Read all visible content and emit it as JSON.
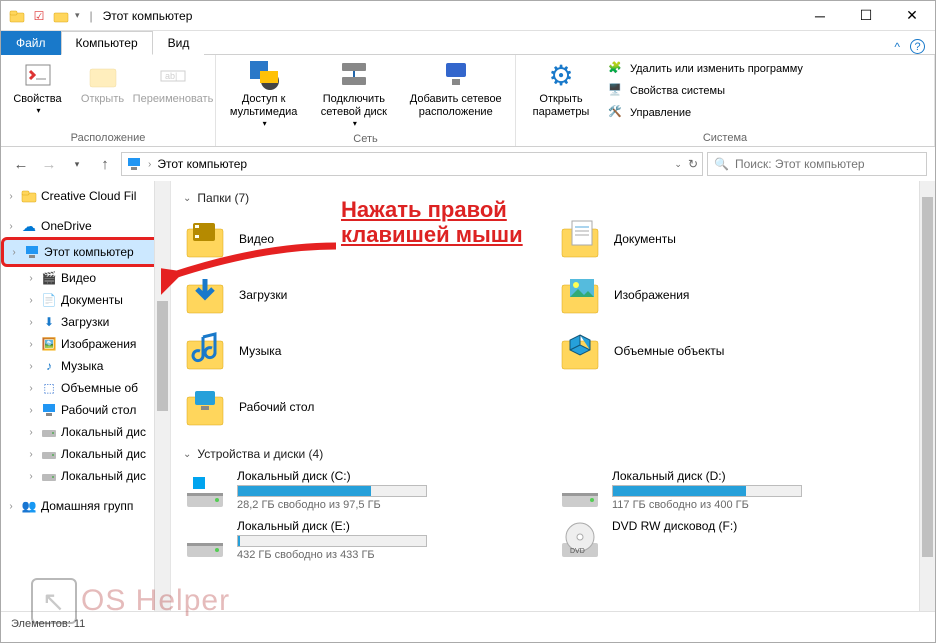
{
  "title": "Этот компьютер",
  "tabs": {
    "file": "Файл",
    "computer": "Компьютер",
    "view": "Вид"
  },
  "ribbon": {
    "group_location": {
      "label": "Расположение",
      "properties": "Свойства",
      "open": "Открыть",
      "rename": "Переименовать"
    },
    "group_network": {
      "label": "Сеть",
      "media": "Доступ к\nмультимедиа",
      "map": "Подключить\nсетевой диск",
      "addloc": "Добавить сетевое\nрасположение"
    },
    "group_system": {
      "label": "Система",
      "settings": "Открыть\nпараметры",
      "uninstall": "Удалить или изменить программу",
      "sysprops": "Свойства системы",
      "manage": "Управление"
    }
  },
  "address": {
    "text": "Этот компьютер",
    "search_placeholder": "Поиск: Этот компьютер"
  },
  "sidebar": {
    "items": [
      {
        "label": "Creative Cloud Fil",
        "icon": "folder"
      },
      {
        "label": "OneDrive",
        "icon": "onedrive"
      },
      {
        "label": "Этот компьютер",
        "icon": "pc",
        "highlighted": true
      },
      {
        "label": "Видео",
        "icon": "video",
        "indent": true
      },
      {
        "label": "Документы",
        "icon": "docs",
        "indent": true
      },
      {
        "label": "Загрузки",
        "icon": "downloads",
        "indent": true
      },
      {
        "label": "Изображения",
        "icon": "images",
        "indent": true
      },
      {
        "label": "Музыка",
        "icon": "music",
        "indent": true
      },
      {
        "label": "Объемные об",
        "icon": "3d",
        "indent": true
      },
      {
        "label": "Рабочий стол",
        "icon": "desktop",
        "indent": true
      },
      {
        "label": "Локальный дис",
        "icon": "disk",
        "indent": true
      },
      {
        "label": "Локальный дис",
        "icon": "disk",
        "indent": true
      },
      {
        "label": "Локальный дис",
        "icon": "disk",
        "indent": true
      },
      {
        "label": "Домашняя групп",
        "icon": "homegroup"
      }
    ]
  },
  "sections": {
    "folders_header": "Папки (7)",
    "drives_header": "Устройства и диски (4)"
  },
  "folders": [
    {
      "name": "Видео",
      "icon": "video"
    },
    {
      "name": "Документы",
      "icon": "docs"
    },
    {
      "name": "Загрузки",
      "icon": "downloads"
    },
    {
      "name": "Изображения",
      "icon": "images"
    },
    {
      "name": "Музыка",
      "icon": "music"
    },
    {
      "name": "Объемные объекты",
      "icon": "3d"
    },
    {
      "name": "Рабочий стол",
      "icon": "desktop"
    }
  ],
  "drives": [
    {
      "name": "Локальный диск (C:)",
      "free": "28,2 ГБ свободно из 97,5 ГБ",
      "pct": 71,
      "icon": "disk-c"
    },
    {
      "name": "Локальный диск (D:)",
      "free": "117 ГБ свободно из 400 ГБ",
      "pct": 71,
      "icon": "disk"
    },
    {
      "name": "Локальный диск (E:)",
      "free": "432 ГБ свободно из 433 ГБ",
      "pct": 1,
      "icon": "disk"
    },
    {
      "name": "DVD RW дисковод (F:)",
      "free": "",
      "pct": -1,
      "icon": "dvd"
    }
  ],
  "statusbar": {
    "items": "Элементов: 11"
  },
  "annotation": "Нажать правой\nклавишей мыши",
  "watermark": "OS Helper"
}
